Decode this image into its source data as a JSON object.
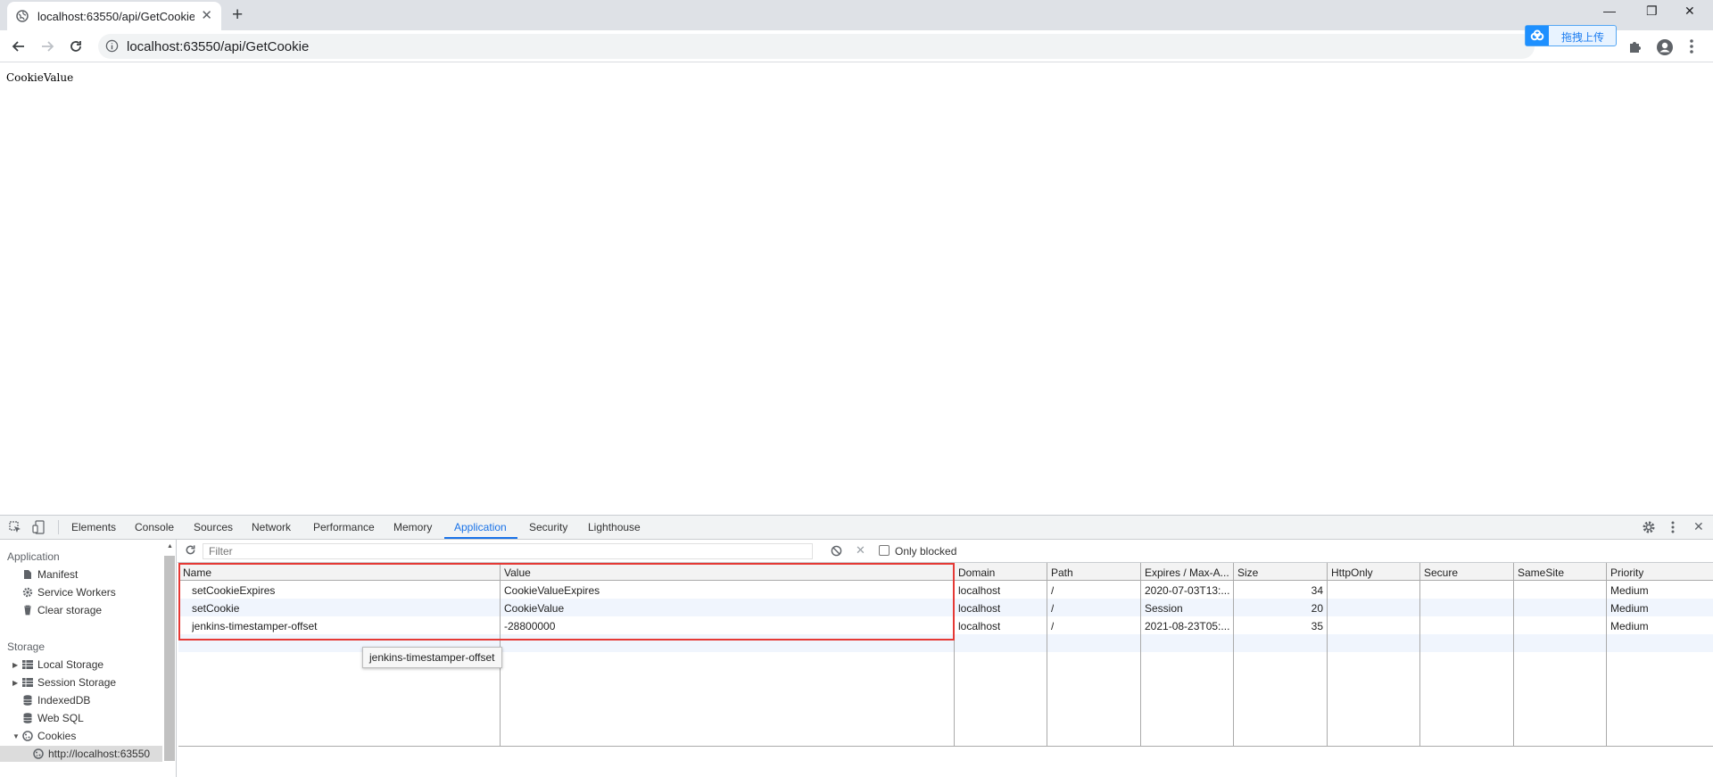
{
  "browser": {
    "tab_title": "localhost:63550/api/GetCookie",
    "url": "localhost:63550/api/GetCookie",
    "extension_badge": "拖拽上传",
    "accent": "#1a73e8"
  },
  "page": {
    "body_text": "CookieValue"
  },
  "devtools": {
    "tabs": [
      {
        "label": "Elements"
      },
      {
        "label": "Console"
      },
      {
        "label": "Sources"
      },
      {
        "label": "Network"
      },
      {
        "label": "Performance"
      },
      {
        "label": "Memory"
      },
      {
        "label": "Application"
      },
      {
        "label": "Security"
      },
      {
        "label": "Lighthouse"
      }
    ],
    "active_tab": "Application",
    "sidebar": {
      "application_header": "Application",
      "application_items": [
        {
          "label": "Manifest",
          "icon": "file-icon"
        },
        {
          "label": "Service Workers",
          "icon": "gear-icon"
        },
        {
          "label": "Clear storage",
          "icon": "trash-icon"
        }
      ],
      "storage_header": "Storage",
      "storage_items": [
        {
          "label": "Local Storage",
          "icon": "grid-icon"
        },
        {
          "label": "Session Storage",
          "icon": "grid-icon"
        },
        {
          "label": "IndexedDB",
          "icon": "database-icon"
        },
        {
          "label": "Web SQL",
          "icon": "database-icon"
        },
        {
          "label": "Cookies",
          "icon": "cookie-icon"
        },
        {
          "label": "http://localhost:63550",
          "icon": "cookie-icon"
        }
      ]
    },
    "filter": {
      "placeholder": "Filter",
      "only_blocked_label": "Only blocked"
    },
    "cookies_table": {
      "columns": [
        "Name",
        "Value",
        "Domain",
        "Path",
        "Expires / Max-A...",
        "Size",
        "HttpOnly",
        "Secure",
        "SameSite",
        "Priority"
      ],
      "rows": [
        {
          "name": "setCookieExpires",
          "value": "CookieValueExpires",
          "domain": "localhost",
          "path": "/",
          "expires": "2020-07-03T13:...",
          "size": "34",
          "httponly": "",
          "secure": "",
          "samesite": "",
          "priority": "Medium"
        },
        {
          "name": "setCookie",
          "value": "CookieValue",
          "domain": "localhost",
          "path": "/",
          "expires": "Session",
          "size": "20",
          "httponly": "",
          "secure": "",
          "samesite": "",
          "priority": "Medium"
        },
        {
          "name": "jenkins-timestamper-offset",
          "value": "-28800000",
          "domain": "localhost",
          "path": "/",
          "expires": "2021-08-23T05:...",
          "size": "35",
          "httponly": "",
          "secure": "",
          "samesite": "",
          "priority": "Medium"
        }
      ]
    },
    "tooltip": "jenkins-timestamper-offset"
  }
}
